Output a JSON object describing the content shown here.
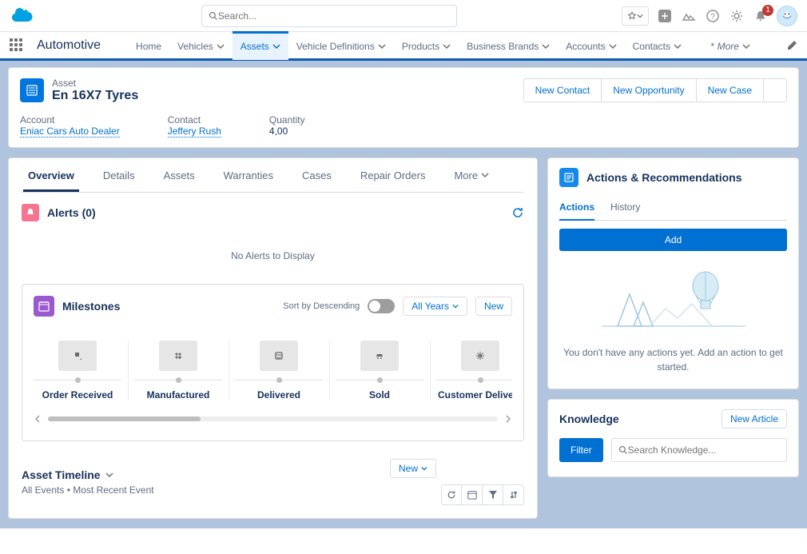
{
  "topbar": {
    "search_placeholder": "Search...",
    "notification_count": "1"
  },
  "navbar": {
    "app_name": "Automotive",
    "tabs": [
      "Home",
      "Vehicles",
      "Assets",
      "Vehicle Definitions",
      "Products",
      "Business Brands",
      "Accounts",
      "Contacts"
    ],
    "active_index": 2,
    "more_label": "More"
  },
  "record": {
    "type_label": "Asset",
    "name": "En 16X7 Tyres",
    "actions": [
      "New Contact",
      "New Opportunity",
      "New Case"
    ],
    "fields": {
      "account_label": "Account",
      "account_value": "Eniac Cars Auto Dealer",
      "contact_label": "Contact",
      "contact_value": "Jeffery Rush",
      "quantity_label": "Quantity",
      "quantity_value": "4,00"
    }
  },
  "detail_tabs": [
    "Overview",
    "Details",
    "Assets",
    "Warranties",
    "Cases",
    "Repair Orders"
  ],
  "detail_more": "More",
  "alerts": {
    "title": "Alerts (0)",
    "empty": "No Alerts to Display"
  },
  "milestones": {
    "title": "Milestones",
    "sort_label": "Sort by Descending",
    "years_label": "All Years",
    "new_label": "New",
    "stages": [
      "Order Received",
      "Manufactured",
      "Delivered",
      "Sold",
      "Customer Delivery"
    ]
  },
  "timeline": {
    "title": "Asset Timeline",
    "subtitle": "All Events • Most Recent Event",
    "new_label": "New"
  },
  "actions_rec": {
    "title": "Actions & Recommendations",
    "tabs": [
      "Actions",
      "History"
    ],
    "add_label": "Add",
    "empty": "You don't have any actions yet. Add an action to get started."
  },
  "knowledge": {
    "title": "Knowledge",
    "new_article": "New Article",
    "filter": "Filter",
    "search_placeholder": "Search Knowledge..."
  }
}
